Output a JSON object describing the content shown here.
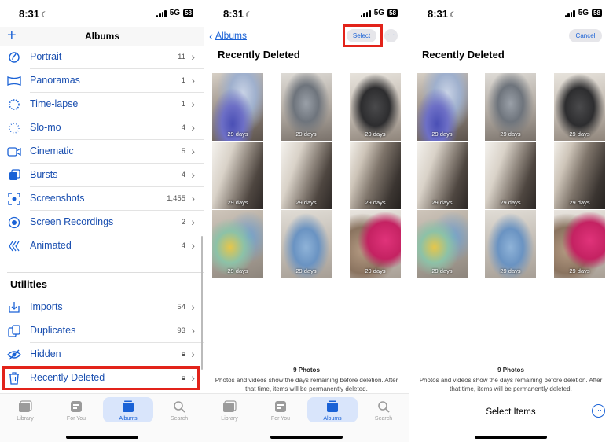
{
  "status": {
    "time": "8:31",
    "network": "5G",
    "battery": "58"
  },
  "panel1": {
    "title": "Albums",
    "media_types": [
      {
        "label": "Portrait",
        "count": "11",
        "icon": "portrait-icon"
      },
      {
        "label": "Panoramas",
        "count": "1",
        "icon": "panorama-icon"
      },
      {
        "label": "Time-lapse",
        "count": "1",
        "icon": "timelapse-icon"
      },
      {
        "label": "Slo-mo",
        "count": "4",
        "icon": "slomo-icon"
      },
      {
        "label": "Cinematic",
        "count": "5",
        "icon": "cinematic-icon"
      },
      {
        "label": "Bursts",
        "count": "4",
        "icon": "bursts-icon"
      },
      {
        "label": "Screenshots",
        "count": "1,455",
        "icon": "screenshot-icon"
      },
      {
        "label": "Screen Recordings",
        "count": "2",
        "icon": "screen-recording-icon"
      },
      {
        "label": "Animated",
        "count": "4",
        "icon": "animated-icon"
      }
    ],
    "utilities_heading": "Utilities",
    "utilities": [
      {
        "label": "Imports",
        "count": "54",
        "icon": "import-icon"
      },
      {
        "label": "Duplicates",
        "count": "93",
        "icon": "duplicates-icon"
      },
      {
        "label": "Hidden",
        "count": "",
        "icon": "hidden-icon",
        "locked": true
      },
      {
        "label": "Recently Deleted",
        "count": "",
        "icon": "trash-icon",
        "locked": true
      }
    ]
  },
  "tabs": [
    {
      "label": "Library",
      "icon": "library-icon"
    },
    {
      "label": "For You",
      "icon": "for-you-icon"
    },
    {
      "label": "Albums",
      "icon": "albums-icon"
    },
    {
      "label": "Search",
      "icon": "search-icon"
    }
  ],
  "panel2": {
    "back_label": "Albums",
    "select_label": "Select",
    "title": "Recently Deleted"
  },
  "panel3": {
    "cancel_label": "Cancel",
    "title": "Recently Deleted",
    "select_items_label": "Select Items"
  },
  "photos": [
    {
      "days": "29 days",
      "kind": "purple-jacket"
    },
    {
      "days": "29 days",
      "kind": "grey-coat"
    },
    {
      "days": "29 days",
      "kind": "dark-hoodie"
    },
    {
      "days": "29 days",
      "kind": "window-bed"
    },
    {
      "days": "29 days",
      "kind": "window-bed"
    },
    {
      "days": "29 days",
      "kind": "window-bed"
    },
    {
      "days": "29 days",
      "kind": "colorful-shirt"
    },
    {
      "days": "29 days",
      "kind": "jeans"
    },
    {
      "days": "29 days",
      "kind": "pink-cloth"
    }
  ],
  "footer": {
    "count": "9 Photos",
    "note": "Photos and videos show the days remaining before deletion. After that time, items will be permanently deleted."
  },
  "colors": {
    "accent": "#1a62d6",
    "highlight": "#e2231a"
  }
}
